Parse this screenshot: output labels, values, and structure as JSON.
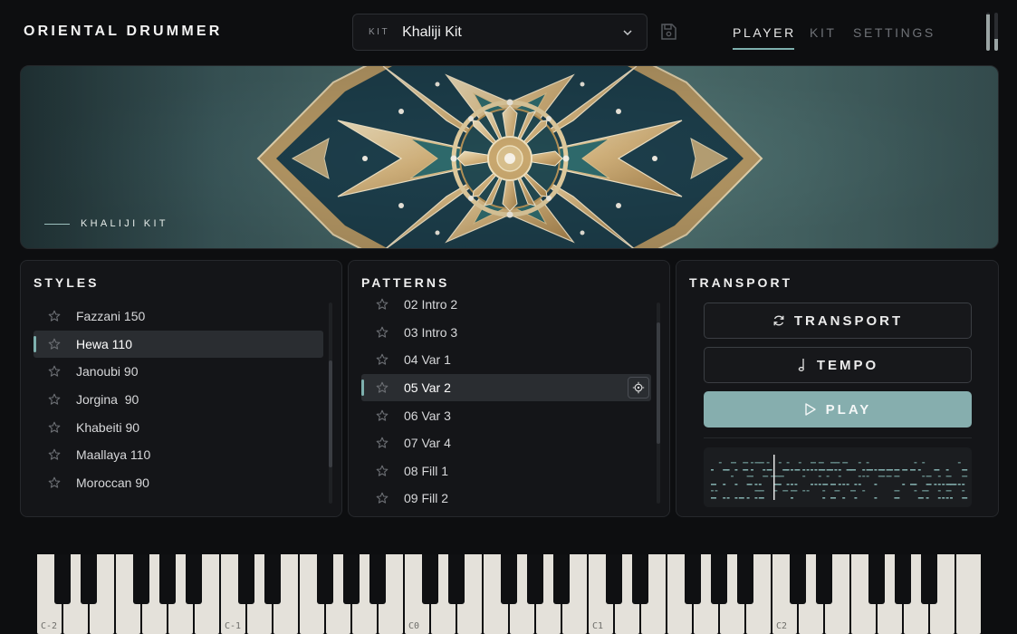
{
  "header": {
    "app_title": "ORIENTAL DRUMMER",
    "kit_tag": "KIT",
    "kit_value": "Khaliji Kit",
    "tabs": [
      {
        "label": "PLAYER",
        "active": true
      },
      {
        "label": "KIT",
        "active": false
      },
      {
        "label": "SETTINGS",
        "active": false
      }
    ],
    "meters": [
      0.95,
      0.3
    ]
  },
  "hero": {
    "label": "KHALIJI KIT"
  },
  "styles": {
    "title": "STYLES",
    "items": [
      "Fazzani 150",
      "Hewa 110",
      "Janoubi 90",
      "Jorgina  90",
      "Khabeiti 90",
      "Maallaya 110",
      "Moroccan 90"
    ],
    "selected_index": 1
  },
  "patterns": {
    "title": "PATTERNS",
    "items": [
      "02 Intro 2",
      "03 Intro 3",
      "04 Var 1",
      "05 Var 2",
      "06 Var 3",
      "07 Var 4",
      "08 Fill 1",
      "09 Fill 2"
    ],
    "selected_index": 3
  },
  "transport": {
    "title": "TRANSPORT",
    "transport_label": "TRANSPORT",
    "tempo_label": "TEMPO",
    "play_label": "PLAY"
  },
  "keyboard": {
    "octave_labels": [
      "C-2",
      "C-1",
      "C0",
      "C1",
      "C2"
    ]
  },
  "colors": {
    "accent": "#7eb0ae",
    "play_button": "#86aeae",
    "background": "#0d0e10",
    "panel": "#141518"
  }
}
